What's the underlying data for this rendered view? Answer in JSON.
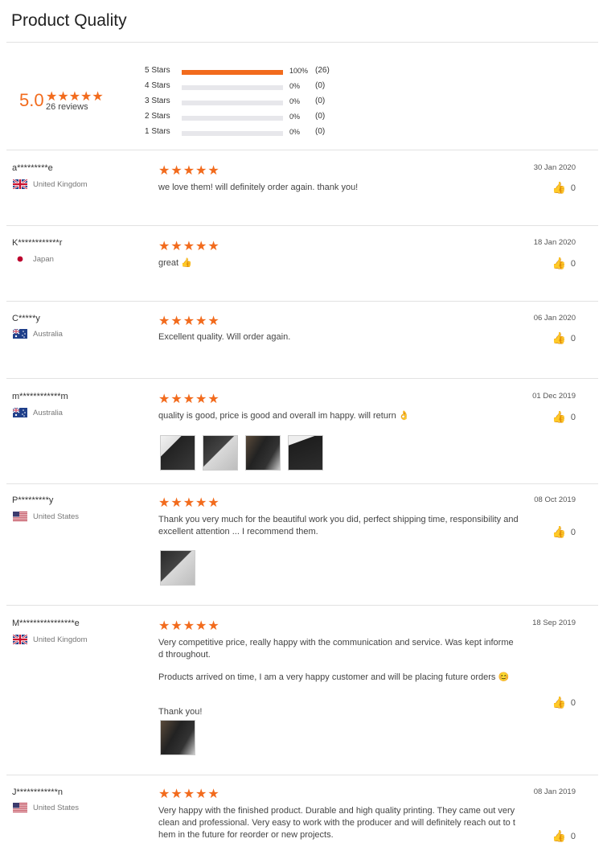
{
  "header": {
    "title": "Product Quality"
  },
  "summary": {
    "score": "5.0",
    "reviews_label": "26 reviews",
    "distribution": [
      {
        "label": "5  Stars",
        "percent": "100%",
        "count": "(26)",
        "fill": 1.0
      },
      {
        "label": "4  Stars",
        "percent": "0%",
        "count": "(0)",
        "fill": 0
      },
      {
        "label": "3  Stars",
        "percent": "0%",
        "count": "(0)",
        "fill": 0
      },
      {
        "label": "2  Stars",
        "percent": "0%",
        "count": "(0)",
        "fill": 0
      },
      {
        "label": "1  Stars",
        "percent": "0%",
        "count": "(0)",
        "fill": 0
      }
    ]
  },
  "reviews": [
    {
      "name": "a*********e",
      "country": "United Kingdom",
      "flag": "uk",
      "rating": 5,
      "date": "30 Jan 2020",
      "likes": "0",
      "paragraphs": [
        "we love  them! will definitely order again. thank you!"
      ],
      "photos": 0
    },
    {
      "name": "K************r",
      "country": "Japan",
      "flag": "jp",
      "rating": 5,
      "date": "18 Jan 2020",
      "likes": "0",
      "paragraphs": [
        "great 👍"
      ],
      "photos": 0
    },
    {
      "name": "C*****y",
      "country": "Australia",
      "flag": "au",
      "rating": 5,
      "date": "06 Jan 2020",
      "likes": "0",
      "paragraphs": [
        "Excellent quality. Will order again."
      ],
      "photos": 0
    },
    {
      "name": "m************m",
      "country": "Australia",
      "flag": "au",
      "rating": 5,
      "date": "01 Dec 2019",
      "likes": "0",
      "paragraphs": [
        "quality is good, price is good and overall im happy. will return 👌"
      ],
      "photos": 4
    },
    {
      "name": "P*********y",
      "country": "United States",
      "flag": "us",
      "rating": 5,
      "date": "08 Oct 2019",
      "likes": "0",
      "paragraphs": [
        "Thank you very much for the beautiful work you did, perfect shipping time, responsibility and excellent attention ... I recommend them."
      ],
      "photos": 1
    },
    {
      "name": "M****************e",
      "country": "United Kingdom",
      "flag": "uk",
      "rating": 5,
      "date": "18 Sep 2019",
      "likes": "0",
      "paragraphs": [
        "Very competitive price, really happy with the communication and service. Was kept informe d throughout.",
        "Products arrived on time, I am a very happy customer and will be placing future orders 😊",
        "Thank you!"
      ],
      "photos": 1
    },
    {
      "name": "J************n",
      "country": "United States",
      "flag": "us",
      "rating": 5,
      "date": "08 Jan 2019",
      "likes": "0",
      "paragraphs": [
        "Very happy with the finished product. Durable and high quality printing. They came out very clean and professional. Very easy to work with the producer and will definitely reach out to t hem in the future for reorder or new projects."
      ],
      "photos": 0
    }
  ],
  "colors": {
    "accent": "#f26b1d",
    "track": "#e7e7eb"
  },
  "icons": {
    "star": "star-icon",
    "like": "thumbs-up-icon"
  }
}
